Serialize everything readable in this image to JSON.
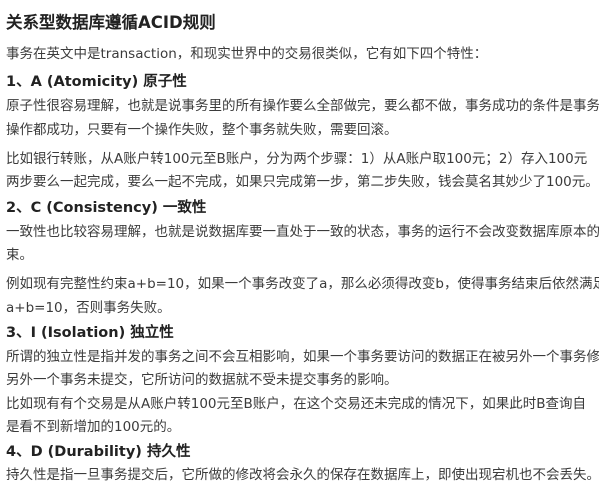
{
  "title": "关系型数据库遵循ACID规则",
  "intro": "事务在英文中是transaction，和现实世界中的交易很类似，它有如下四个特性：",
  "sections": [
    {
      "heading": "1、A (Atomicity) 原子性",
      "lines": [
        "原子性很容易理解，也就是说事务里的所有操作要么全部做完，要么都不做，事务成功的条件是事务",
        "操作都成功，只要有一个操作失败，整个事务就失败，需要回滚。",
        "比如银行转账，从A账户转100元至B账户，分为两个步骤：1）从A账户取100元；2）存入100元",
        "两步要么一起完成，要么一起不完成，如果只完成第一步，第二步失败，钱会莫名其妙少了100元。"
      ]
    },
    {
      "heading": "2、C (Consistency) 一致性",
      "lines": [
        "一致性也比较容易理解，也就是说数据库要一直处于一致的状态，事务的运行不会改变数据库原本的",
        "束。",
        "例如现有完整性约束a+b=10，如果一个事务改变了a，那么必须得改变b，使得事务结束后依然满足",
        "a+b=10，否则事务失败。"
      ]
    },
    {
      "heading": "3、I (Isolation) 独立性",
      "lines": [
        "所谓的独立性是指并发的事务之间不会互相影响，如果一个事务要访问的数据正在被另外一个事务修",
        "另外一个事务未提交，它所访问的数据就不受未提交事务的影响。",
        "比如现有有个交易是从A账户转100元至B账户，在这个交易还未完成的情况下，如果此时B查询自",
        "是看不到新增加的100元的。"
      ]
    },
    {
      "heading": "4、D (Durability) 持久性",
      "lines": [
        "持久性是指一旦事务提交后，它所做的修改将会永久的保存在数据库上，即使出现宕机也不会丢失。"
      ]
    }
  ]
}
